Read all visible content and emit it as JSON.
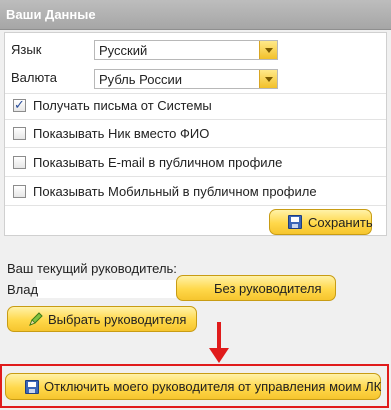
{
  "header": {
    "title": "Ваши Данные"
  },
  "language": {
    "label": "Язык",
    "value": "Русский"
  },
  "currency": {
    "label": "Валюта",
    "value": "Рубль России"
  },
  "options": [
    {
      "label": "Получать письма от Системы",
      "checked": true
    },
    {
      "label": "Показывать Ник вместо ФИО",
      "checked": false
    },
    {
      "label": "Показывать E-mail в публичном профиле",
      "checked": false
    },
    {
      "label": "Показывать Мобильный в публичном профиле",
      "checked": false
    }
  ],
  "save_button": {
    "label": "Сохранить",
    "icon": "floppy-disk-icon"
  },
  "manager": {
    "title": "Ваш текущий руководитель:",
    "name": "Влад",
    "no_manager_button": "Без руководителя",
    "choose_button": "Выбрать руководителя",
    "choose_icon": "pencil-icon",
    "detach_button": "Отключить моего руководителя от управления моим ЛК",
    "detach_icon": "floppy-disk-icon"
  },
  "colors": {
    "annotation": "#e01b1b",
    "button": "#ffd84a",
    "checkbox_check": "#2a4d9a"
  }
}
